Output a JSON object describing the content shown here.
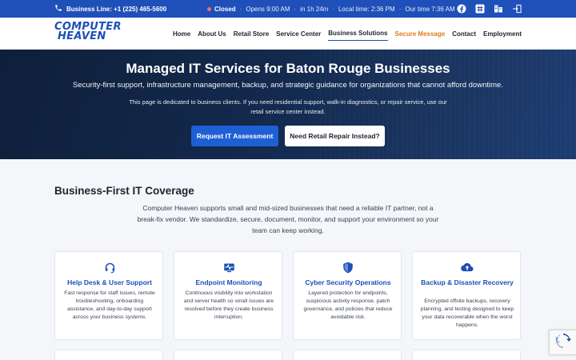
{
  "topbar": {
    "phone": "Business Line: +1 (225) 465-5600",
    "status_label": "Closed",
    "opens": "Opens 9:00 AM",
    "opens_in": "in 1h 24m",
    "local_time": "Local time: 2:36 PM",
    "our_time": "Our time 7:36 AM",
    "icons": [
      "facebook-icon",
      "hashtag-icon",
      "business-icon",
      "login-icon"
    ]
  },
  "brand": {
    "logo_line1": "COMPUTER",
    "logo_line2": "HEAVEN",
    "color": "#1d4fb8"
  },
  "nav": {
    "items": [
      {
        "label": "Home"
      },
      {
        "label": "About Us"
      },
      {
        "label": "Retail Store"
      },
      {
        "label": "Service Center"
      },
      {
        "label": "Business Solutions"
      },
      {
        "label": "Secure Message"
      },
      {
        "label": "Contact"
      },
      {
        "label": "Employment"
      }
    ],
    "active": "Business Solutions",
    "accent": "Secure Message",
    "accent_color": "#e07a1f"
  },
  "hero": {
    "title": "Managed IT Services for Baton Rouge Businesses",
    "subtitle": "Security-first support, infrastructure management, backup, and strategic guidance for organizations that cannot afford downtime.",
    "note": "This page is dedicated to business clients. If you need residential support, walk-in diagnostics, or repair service, use our retail service center instead.",
    "primary_button": "Request IT Assessment",
    "secondary_button": "Need Retail Repair Instead?"
  },
  "coverage": {
    "heading": "Business-First IT Coverage",
    "intro": "Computer Heaven supports small and mid-sized businesses that need a reliable IT partner, not a break-fix vendor. We standardize, secure, document, monitor, and support your environment so your team can keep working.",
    "cards": [
      {
        "icon": "headset-icon",
        "title": "Help Desk & User Support",
        "desc": "Fast response for staff issues, remote troubleshooting, onboarding assistance, and day-to-day support across your business systems."
      },
      {
        "icon": "monitor-pulse-icon",
        "title": "Endpoint Monitoring",
        "desc": "Continuous visibility into workstation and server health so small issues are resolved before they create business interruption."
      },
      {
        "icon": "shield-icon",
        "title": "Cyber Security Operations",
        "desc": "Layered protection for endpoints, suspicious activity response, patch governance, and policies that reduce avoidable risk."
      },
      {
        "icon": "cloud-upload-icon",
        "title": "Backup & Disaster Recovery",
        "desc": "Encrypted offsite backups, recovery planning, and testing designed to keep your data recoverable when the worst happens."
      }
    ]
  }
}
